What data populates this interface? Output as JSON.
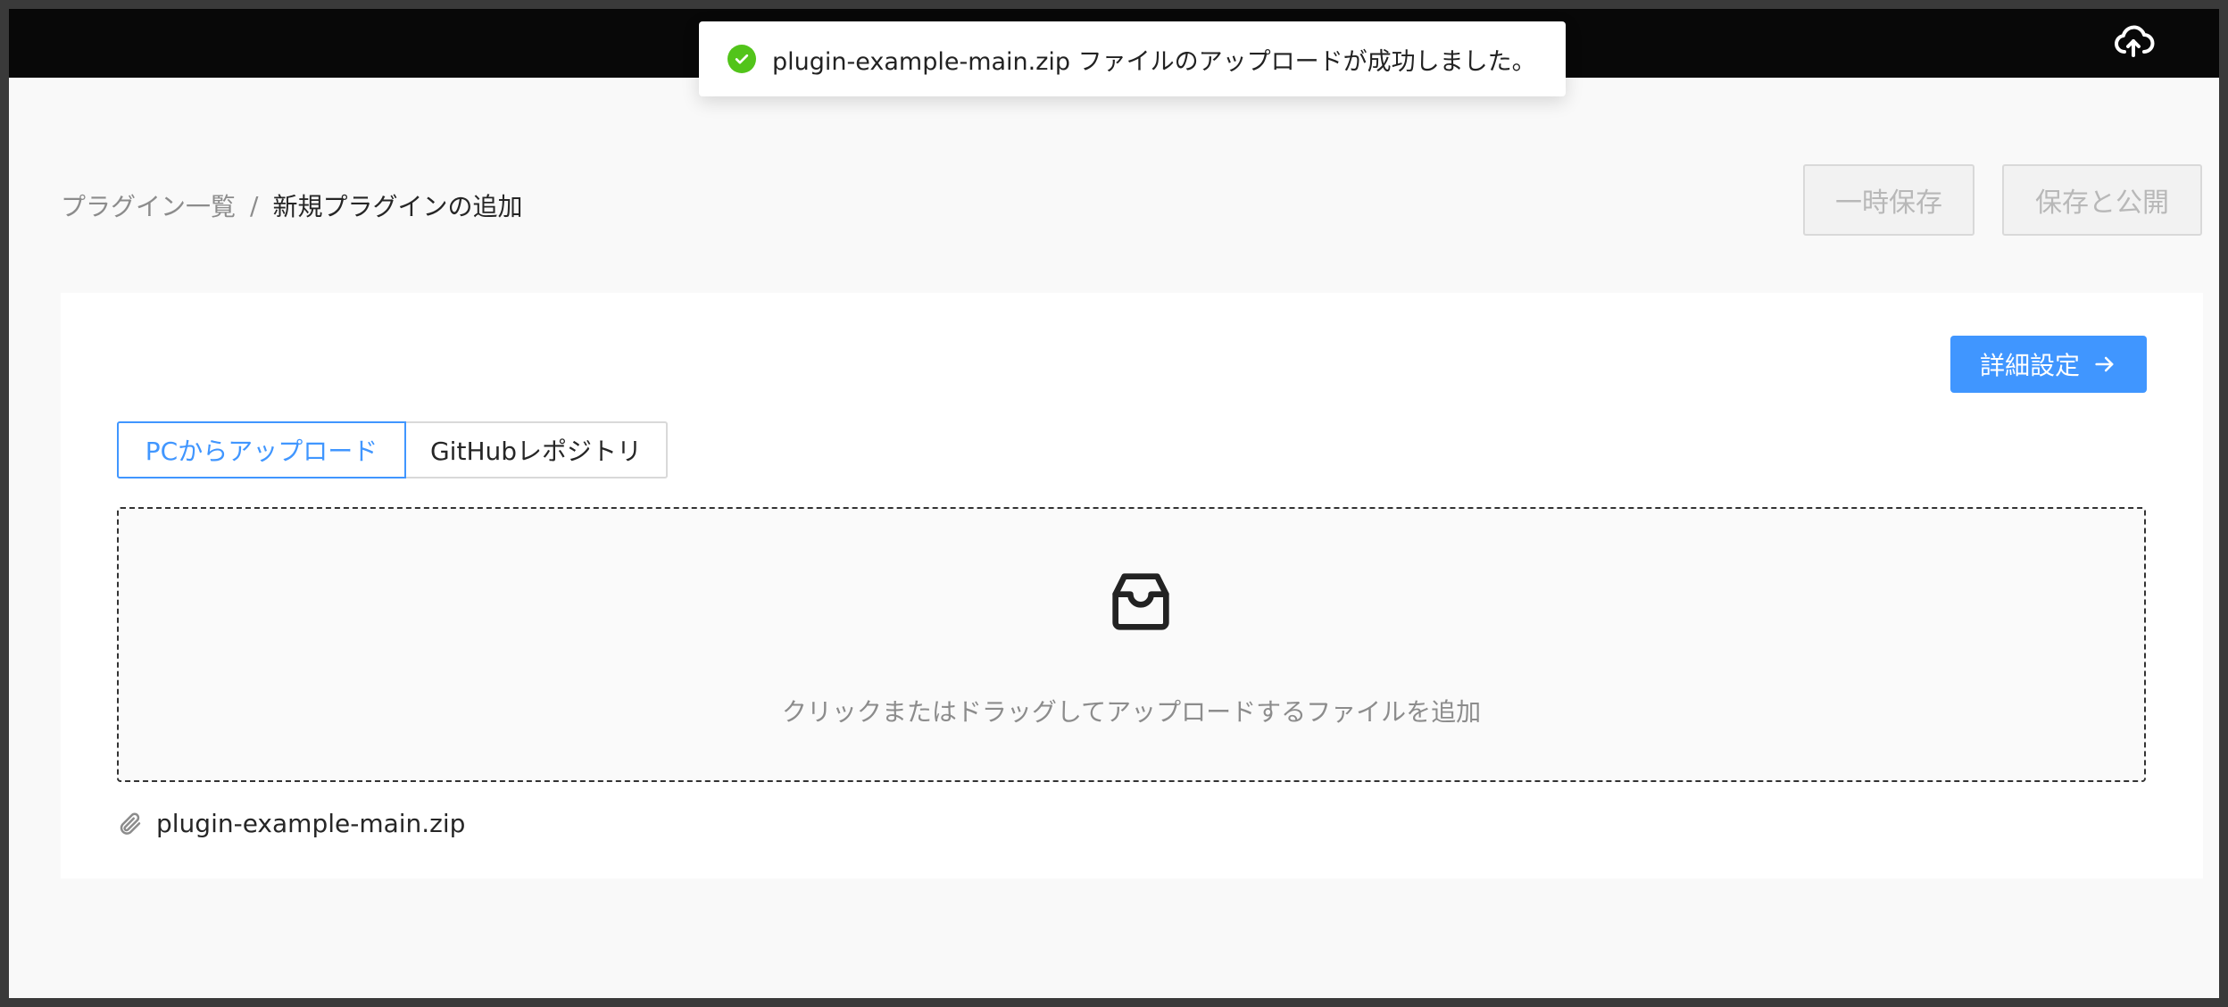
{
  "toast": {
    "message": "plugin-example-main.zip ファイルのアップロードが成功しました。",
    "status_color": "#52c41a"
  },
  "topbar": {
    "upload_icon": "cloud-upload-icon"
  },
  "breadcrumb": {
    "parent": "プラグイン一覧",
    "separator": "/",
    "current": "新規プラグインの追加"
  },
  "header_actions": {
    "draft_label": "一時保存",
    "publish_label": "保存と公開"
  },
  "card": {
    "advanced_label": "詳細設定",
    "tabs": [
      {
        "label": "PCからアップロード",
        "active": true
      },
      {
        "label": "GitHubレポジトリ",
        "active": false
      }
    ],
    "dropzone_hint": "クリックまたはドラッグしてアップロードするファイルを追加",
    "dropzone_icon": "inbox-icon",
    "uploaded_file": "plugin-example-main.zip"
  },
  "colors": {
    "accent": "#4096ff",
    "topbar": "#080808"
  }
}
